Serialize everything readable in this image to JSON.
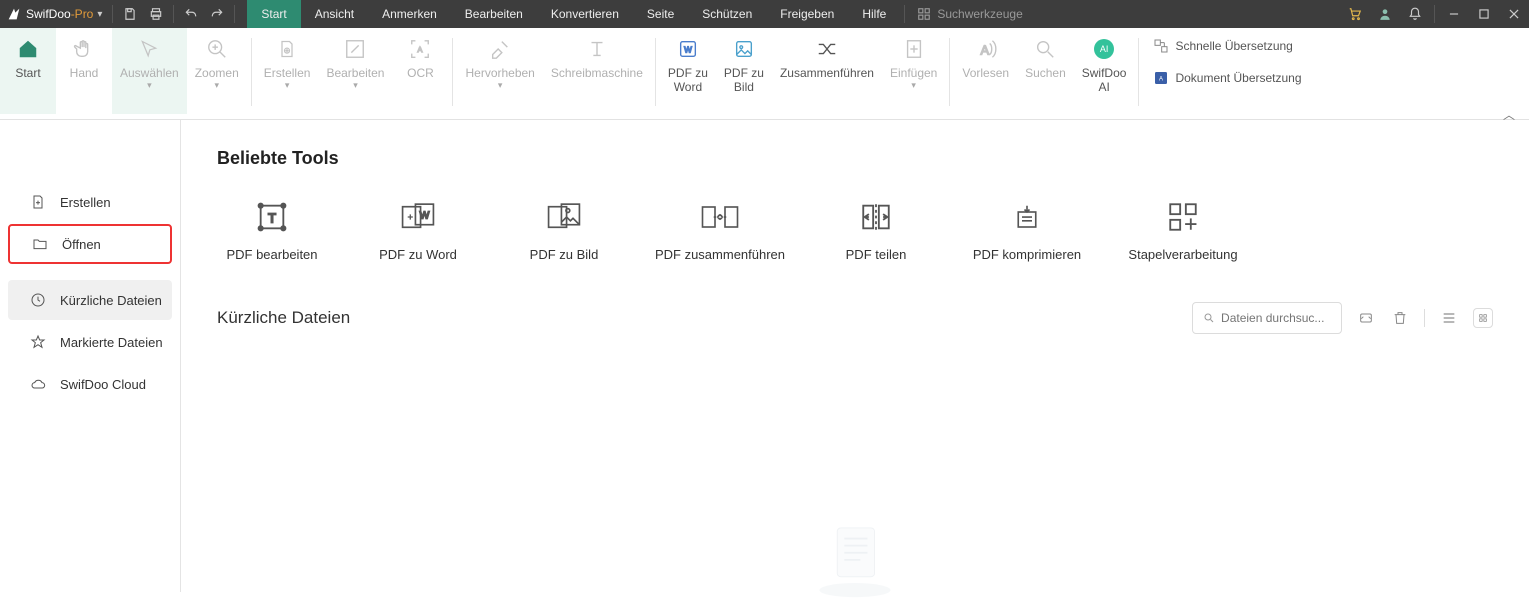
{
  "brand": {
    "name1": "SwifDoo",
    "name2": "-Pro"
  },
  "menu": {
    "start": "Start",
    "view": "Ansicht",
    "annotate": "Anmerken",
    "edit": "Bearbeiten",
    "convert": "Konvertieren",
    "page": "Seite",
    "protect": "Schützen",
    "share": "Freigeben",
    "help": "Hilfe"
  },
  "search_tools": "Suchwerkzeuge",
  "ribbon": {
    "start": "Start",
    "hand": "Hand",
    "select": "Auswählen",
    "zoom": "Zoomen",
    "create": "Erstellen",
    "edit": "Bearbeiten",
    "ocr": "OCR",
    "highlight": "Hervorheben",
    "typewriter": "Schreibmaschine",
    "pdf2word_l1": "PDF zu",
    "pdf2word_l2": "Word",
    "pdf2img_l1": "PDF zu",
    "pdf2img_l2": "Bild",
    "merge": "Zusammenführen",
    "insert": "Einfügen",
    "read": "Vorlesen",
    "search": "Suchen",
    "ai_l1": "SwifDoo",
    "ai_l2": "AI",
    "quick_translate": "Schnelle Übersetzung",
    "doc_translate": "Dokument Übersetzung"
  },
  "sidebar": {
    "create": "Erstellen",
    "open": "Öffnen",
    "recent": "Kürzliche Dateien",
    "marked": "Markierte Dateien",
    "cloud": "SwifDoo Cloud"
  },
  "main": {
    "popular_heading": "Beliebte Tools",
    "tools": {
      "edit": "PDF bearbeiten",
      "toword": "PDF zu Word",
      "toimg": "PDF zu Bild",
      "merge": "PDF zusammenführen",
      "split": "PDF teilen",
      "compress": "PDF komprimieren",
      "batch": "Stapelverarbeitung"
    },
    "recent_heading": "Kürzliche Dateien",
    "search_placeholder": "Dateien durchsuc..."
  }
}
